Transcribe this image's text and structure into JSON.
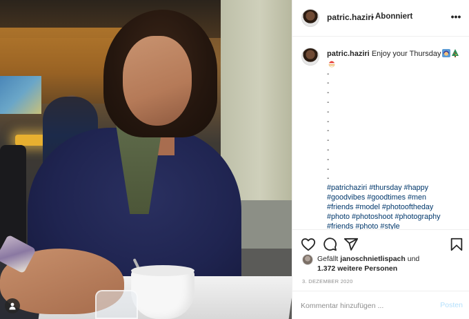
{
  "post": {
    "username": "patric.haziri",
    "dot": "•",
    "follow_status": "Abonniert",
    "more_label": "•••"
  },
  "caption": {
    "username": "patric.haziri",
    "text": "Enjoy your Thursday",
    "emojis": [
      "woman-with-headscarf-emoji",
      "christmas-tree-emoji",
      "santa-emoji"
    ],
    "dashes": [
      "-",
      "-",
      "-",
      "-",
      "-",
      "-",
      "-",
      "-",
      "-",
      "-",
      "-",
      "-"
    ],
    "hashtag_lines": [
      "#patrichaziri #thursday #happy",
      "#goodvibes #goodtimes #men",
      "#friends #model #photooftheday",
      "#photo #photoshoot #photography",
      "#friends #photo #style"
    ]
  },
  "actions": {
    "icons": [
      "heart-icon",
      "comment-icon",
      "share-icon",
      "bookmark-icon"
    ]
  },
  "likes": {
    "prefix": "Gefällt",
    "user": "janoschnietlispach",
    "and": "und",
    "others": "1.372 weitere Personen"
  },
  "date": "3. DEZEMBER 2020",
  "comment": {
    "placeholder": "Kommentar hinzufügen ...",
    "post_label": "Posten"
  },
  "colors": {
    "text": "#262626",
    "secondary": "#8e8e8e",
    "hashtag": "#00376b",
    "post_disabled": "#b2dffc",
    "border": "#efefef"
  }
}
